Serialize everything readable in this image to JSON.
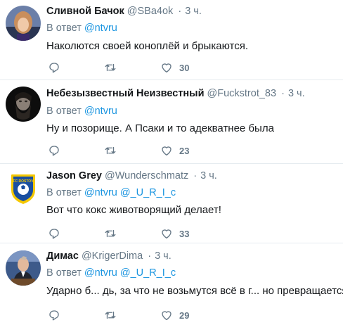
{
  "reply_prefix": "В ответ",
  "tweets": [
    {
      "name": "Сливной Бачок",
      "handle": "@SBa4ok",
      "time": "3 ч.",
      "mentions": [
        "@ntvru"
      ],
      "text": "Наколются своей коноплёй и брыкаются.",
      "likes": "30",
      "avatar": "woman-portrait"
    },
    {
      "name": "Небезызвестный Неизвестный",
      "handle": "@Fuckstrot_83",
      "time": "3 ч.",
      "mentions": [
        "@ntvru"
      ],
      "text": "Ну и позорище. А Псаки и то адекватнее была",
      "likes": "23",
      "avatar": "dark-bearded-face"
    },
    {
      "name": "Jason Grey",
      "handle": "@Wunderschmatz",
      "time": "3 ч.",
      "mentions": [
        "@ntvru",
        "@_U_R_I_c"
      ],
      "text": "Вот что кокс животворящий делает!",
      "likes": "33",
      "avatar": "fc-rostov-logo"
    },
    {
      "name": "Димас",
      "handle": "@KrigerDima",
      "time": "3 ч.",
      "mentions": [
        "@ntvru",
        "@_U_R_I_c"
      ],
      "text": "Ударно б... дь, за что не возьмутся всё в г... но превращается",
      "likes": "29",
      "avatar": "man-at-podium"
    }
  ],
  "colors": {
    "link": "#1b95e0",
    "secondary": "#657786",
    "text": "#14171a"
  }
}
